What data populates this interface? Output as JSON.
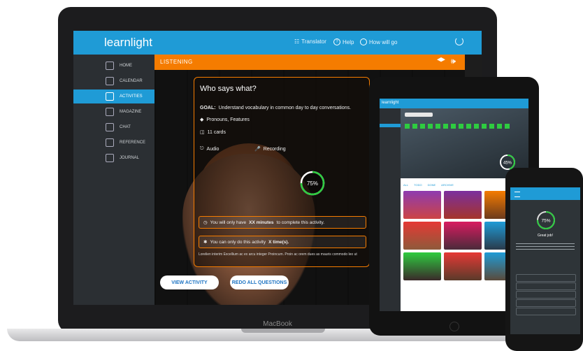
{
  "laptop": {
    "brand": "MacBook",
    "app": {
      "logo": "learnlight",
      "topnav": [
        {
          "label": "Translator",
          "icon": "translate-icon"
        },
        {
          "label": "Help",
          "icon": "help-icon"
        },
        {
          "label": "How will go",
          "icon": "user-icon"
        }
      ],
      "power_icon": "power-icon",
      "sidebar": [
        {
          "label": "Home",
          "icon": "home-icon",
          "active": false
        },
        {
          "label": "Calendar",
          "icon": "calendar-icon",
          "active": false
        },
        {
          "label": "Activities",
          "icon": "activities-icon",
          "active": true
        },
        {
          "label": "Magazine",
          "icon": "magazine-icon",
          "active": false
        },
        {
          "label": "Chat",
          "icon": "chat-icon",
          "active": false
        },
        {
          "label": "Reference",
          "icon": "reference-icon",
          "active": false
        },
        {
          "label": "Journal",
          "icon": "journal-icon",
          "active": false
        }
      ],
      "section_title": "LISTENING",
      "header_icons": [
        "graduation-cap-icon",
        "speaker-icon"
      ],
      "card": {
        "title": "Who says what?",
        "goal_label": "GOAL:",
        "goal_text": "Understand vocabulary in common day to day conversations.",
        "tags": "Pronouns, Features",
        "cards_count": "11 cards",
        "audio_label": "Audio",
        "recording_label": "Recording",
        "progress": "75%",
        "progress_value": 0.75,
        "time_note_prefix": "You will only have",
        "time_note_bold": "XX minutes",
        "time_note_suffix": "to complete this activity.",
        "done_note_prefix": "You can only do this activity",
        "done_note_bold": "X time(s).",
        "footnote": "Lorelien interim Excellium ac ex arcu integer Proincum. Proin ac orem dues as mauris commodo leo ut"
      },
      "buttons": {
        "view_activity": "VIEW ACTIVITY",
        "redo_all": "REDO ALL QUESTIONS"
      }
    }
  },
  "tablet": {
    "logo": "learnlight",
    "progress": "45%",
    "progress_value": 0.45,
    "tabs": [
      "ALL",
      "TODO",
      "DONE",
      "ARCHIVE"
    ]
  },
  "phone": {
    "progress": "75%",
    "progress_value": 0.75,
    "greeting": "Great job!"
  },
  "colors": {
    "accent_blue": "#1f9bd6",
    "accent_orange": "#f57c00",
    "sidebar_dark": "#2b2f33",
    "progress_green": "#2ecc40"
  }
}
